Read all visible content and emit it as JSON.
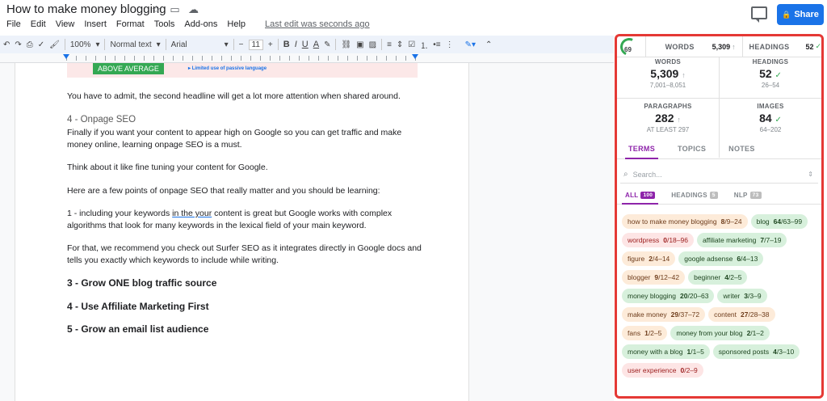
{
  "document": {
    "title": "How to make money blogging",
    "menu": [
      "File",
      "Edit",
      "View",
      "Insert",
      "Format",
      "Tools",
      "Add-ons",
      "Help"
    ],
    "last_edit": "Last edit was seconds ago",
    "share_label": "Share"
  },
  "toolbar": {
    "zoom": "100%",
    "style": "Normal text",
    "font": "Arial",
    "font_size": "11",
    "bold": "B",
    "italic": "I",
    "underline": "U",
    "text_color": "A"
  },
  "page": {
    "banner_tag": "ABOVE AVERAGE",
    "banner_note": "Limited use of passive language",
    "para1": "You have to admit, the second headline will get a lot more attention when shared around.",
    "heading_onpage": "4 - Onpage SEO",
    "para2": "Finally if you want your content to appear high on Google so you can get traffic and make money online, learning onpage SEO is a must.",
    "para3": "Think about it like fine tuning your content for Google.",
    "para4": "Here are a few points of onpage SEO that really matter and you should be learning:",
    "para5_pre": "1 - including your keywords ",
    "para5_squiggle": "in the your",
    "para5_post": " content is great but Google works with complex algorithms that look for many keywords in the lexical field of your main keyword.",
    "para6": "For that, we recommend you check out Surfer SEO as it integrates directly in Google docs and tells you exactly which keywords to include while writing.",
    "h3_1": "3 - Grow ONE blog traffic source",
    "h3_2": "4 - Use Affiliate Marketing First",
    "h3_3": "5 - Grow an email list audience"
  },
  "surfer": {
    "score": "69",
    "summary": {
      "words_label": "WORDS",
      "words_value": "5,309",
      "words_arrow": "↑",
      "headings_label": "HEADINGS",
      "headings_value": "52",
      "headings_check": "✓"
    },
    "stats": [
      {
        "label": "WORDS",
        "value": "5,309",
        "mark": "↑",
        "range": "7,001–8,051"
      },
      {
        "label": "HEADINGS",
        "value": "52",
        "mark": "✓",
        "range": "26–54"
      },
      {
        "label": "PARAGRAPHS",
        "value": "282",
        "mark": "↑",
        "range": "AT LEAST 297"
      },
      {
        "label": "IMAGES",
        "value": "84",
        "mark": "✓",
        "range": "64–202"
      }
    ],
    "tabs": [
      "TERMS",
      "TOPICS",
      "NOTES"
    ],
    "search_placeholder": "Search...",
    "filters": [
      {
        "label": "ALL",
        "count": "100"
      },
      {
        "label": "HEADINGS",
        "count": "5"
      },
      {
        "label": "NLP",
        "count": "73"
      }
    ],
    "terms": [
      {
        "name": "how to make money blogging",
        "value": "8",
        "range": "/9–24",
        "status": "over"
      },
      {
        "name": "blog",
        "value": "64",
        "range": "/63–99",
        "status": "good"
      },
      {
        "name": "wordpress",
        "value": "0",
        "range": "/18–96",
        "status": "under"
      },
      {
        "name": "affiliate marketing",
        "value": "7",
        "range": "/7–19",
        "status": "good"
      },
      {
        "name": "figure",
        "value": "2",
        "range": "/4–14",
        "status": "over"
      },
      {
        "name": "google adsense",
        "value": "6",
        "range": "/4–13",
        "status": "good"
      },
      {
        "name": "blogger",
        "value": "9",
        "range": "/12–42",
        "status": "over"
      },
      {
        "name": "beginner",
        "value": "4",
        "range": "/2–5",
        "status": "good"
      },
      {
        "name": "money blogging",
        "value": "20",
        "range": "/20–63",
        "status": "good"
      },
      {
        "name": "writer",
        "value": "3",
        "range": "/3–9",
        "status": "good"
      },
      {
        "name": "make money",
        "value": "29",
        "range": "/37–72",
        "status": "over"
      },
      {
        "name": "content",
        "value": "27",
        "range": "/28–38",
        "status": "over"
      },
      {
        "name": "fans",
        "value": "1",
        "range": "/2–5",
        "status": "over"
      },
      {
        "name": "money from your blog",
        "value": "2",
        "range": "/1–2",
        "status": "good"
      },
      {
        "name": "money with a blog",
        "value": "1",
        "range": "/1–5",
        "status": "good"
      },
      {
        "name": "sponsored posts",
        "value": "4",
        "range": "/3–10",
        "status": "good"
      },
      {
        "name": "user experience",
        "value": "0",
        "range": "/2–9",
        "status": "under"
      }
    ]
  }
}
